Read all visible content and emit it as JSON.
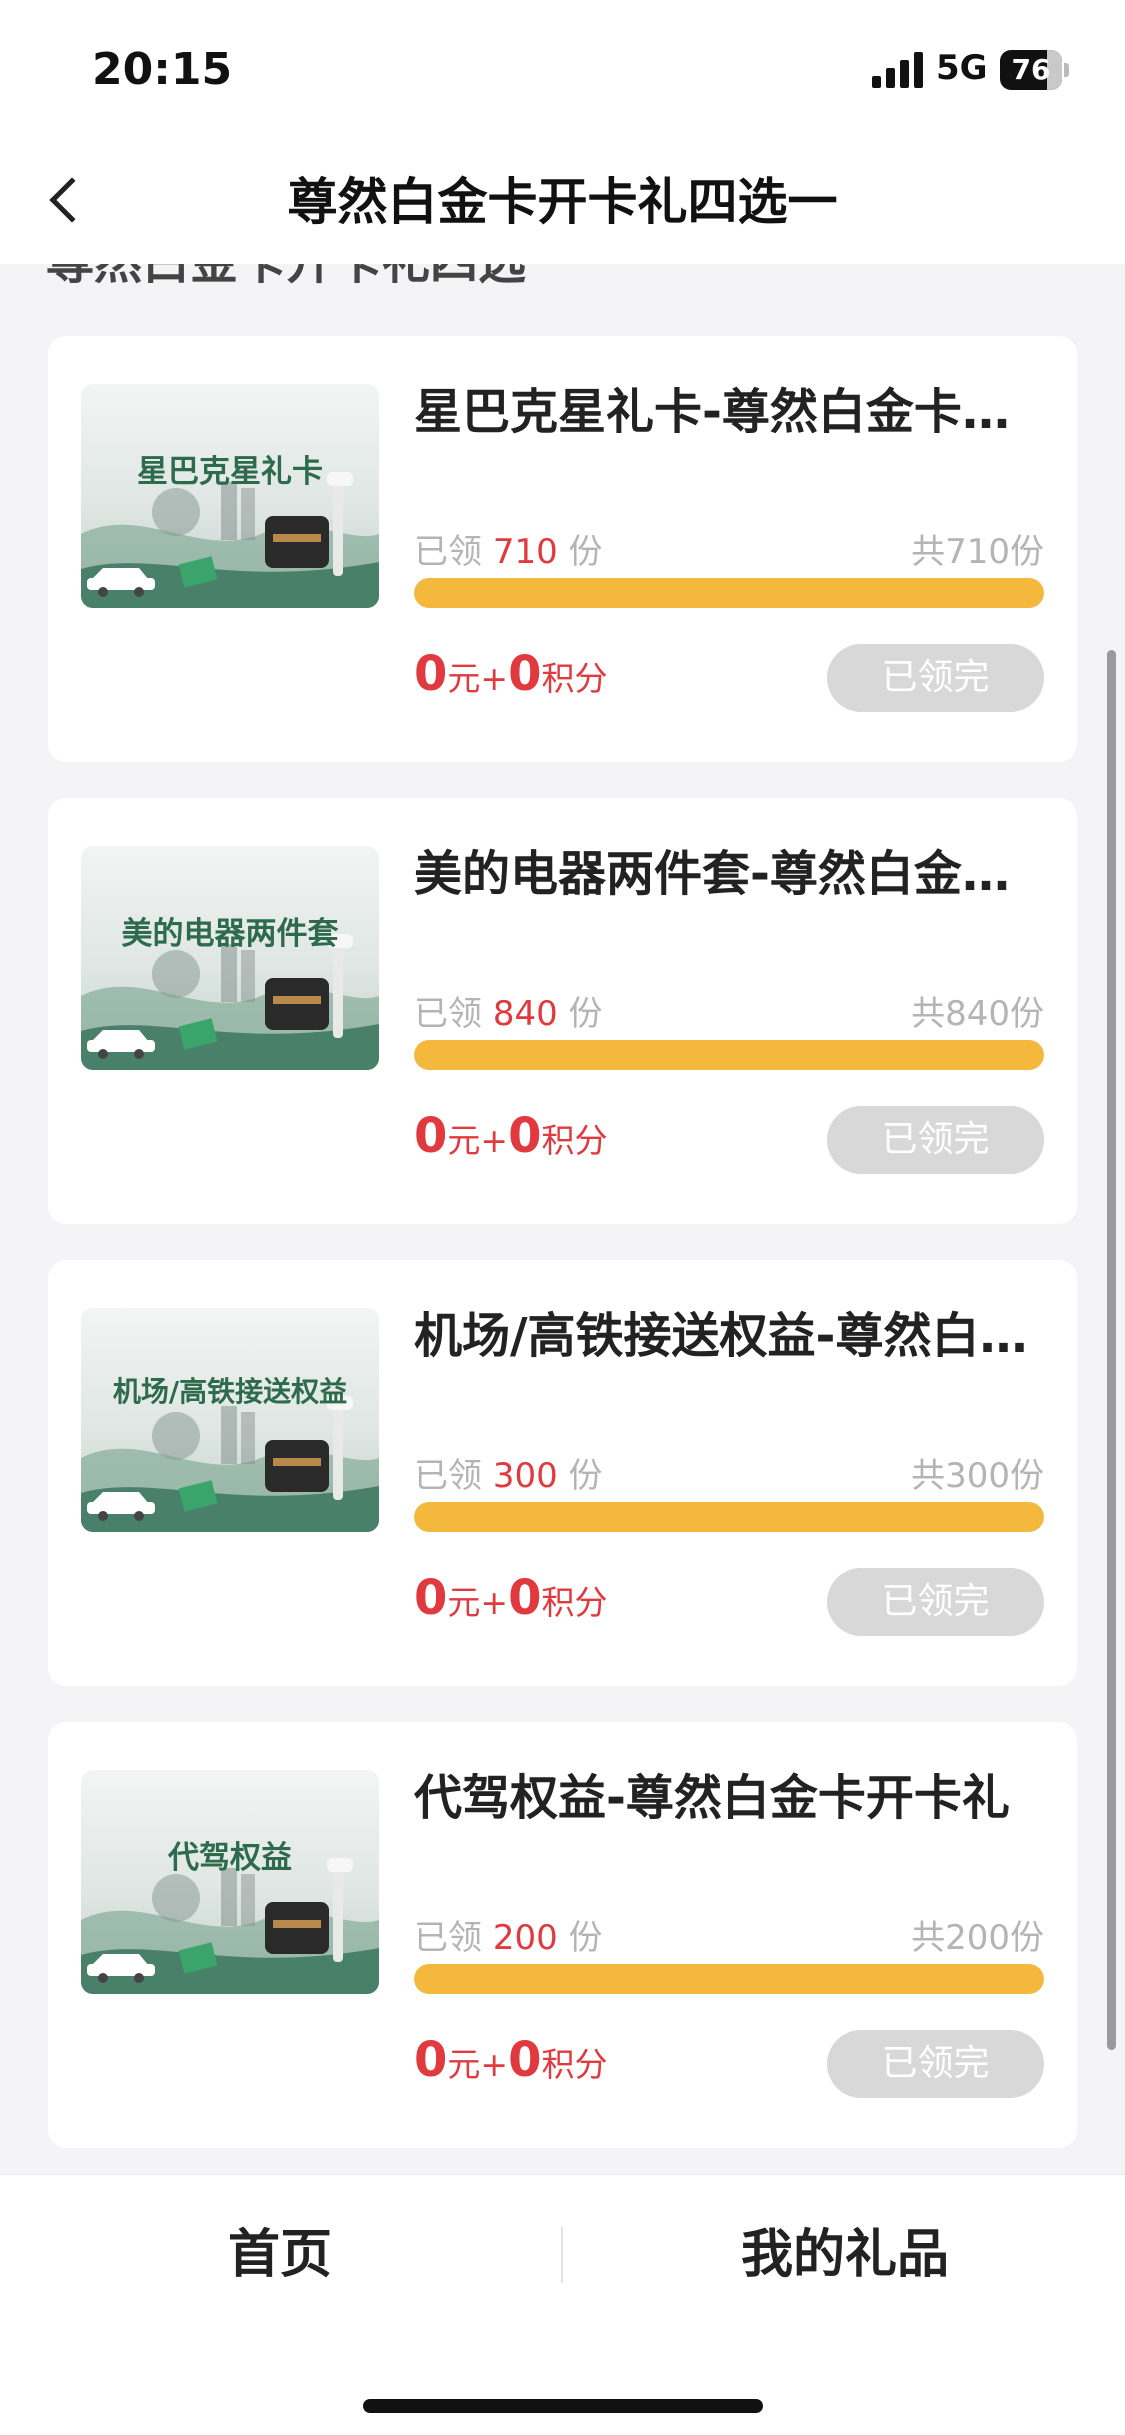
{
  "status_bar": {
    "time": "20:15",
    "network": "5G",
    "battery": "76",
    "battery_level": 0.76
  },
  "nav": {
    "title": "尊然白金卡开卡礼四选一"
  },
  "section_title": "尊然白金卡开卡礼四选一",
  "items": [
    {
      "thumb_text": "星巴克星礼卡",
      "title": "星巴克星礼卡-尊然白金卡开卡礼",
      "claimed_prefix": "已领",
      "claimed": "710",
      "claimed_suffix": "份",
      "total": "共710份",
      "progress": 1.0,
      "price_yuan": "0",
      "price_yuan_unit": "元+",
      "price_points": "0",
      "price_points_unit": "积分",
      "button": "已领完"
    },
    {
      "thumb_text": "美的电器两件套",
      "title": "美的电器两件套-尊然白金卡开卡礼",
      "claimed_prefix": "已领",
      "claimed": "840",
      "claimed_suffix": "份",
      "total": "共840份",
      "progress": 1.0,
      "price_yuan": "0",
      "price_yuan_unit": "元+",
      "price_points": "0",
      "price_points_unit": "积分",
      "button": "已领完"
    },
    {
      "thumb_text": "机场/高铁接送权益",
      "title": "机场/高铁接送权益-尊然白金卡开卡礼",
      "claimed_prefix": "已领",
      "claimed": "300",
      "claimed_suffix": "份",
      "total": "共300份",
      "progress": 1.0,
      "price_yuan": "0",
      "price_yuan_unit": "元+",
      "price_points": "0",
      "price_points_unit": "积分",
      "button": "已领完"
    },
    {
      "thumb_text": "代驾权益",
      "title": "代驾权益-尊然白金卡开卡礼",
      "claimed_prefix": "已领",
      "claimed": "200",
      "claimed_suffix": "份",
      "total": "共200份",
      "progress": 1.0,
      "price_yuan": "0",
      "price_yuan_unit": "元+",
      "price_points": "0",
      "price_points_unit": "积分",
      "button": "已领完"
    }
  ],
  "tabs": {
    "home": "首页",
    "my_gifts": "我的礼品"
  },
  "colors": {
    "accent_red": "#e0393e",
    "progress_yellow": "#f4b83d",
    "disabled_gray": "#d8d8d8"
  }
}
